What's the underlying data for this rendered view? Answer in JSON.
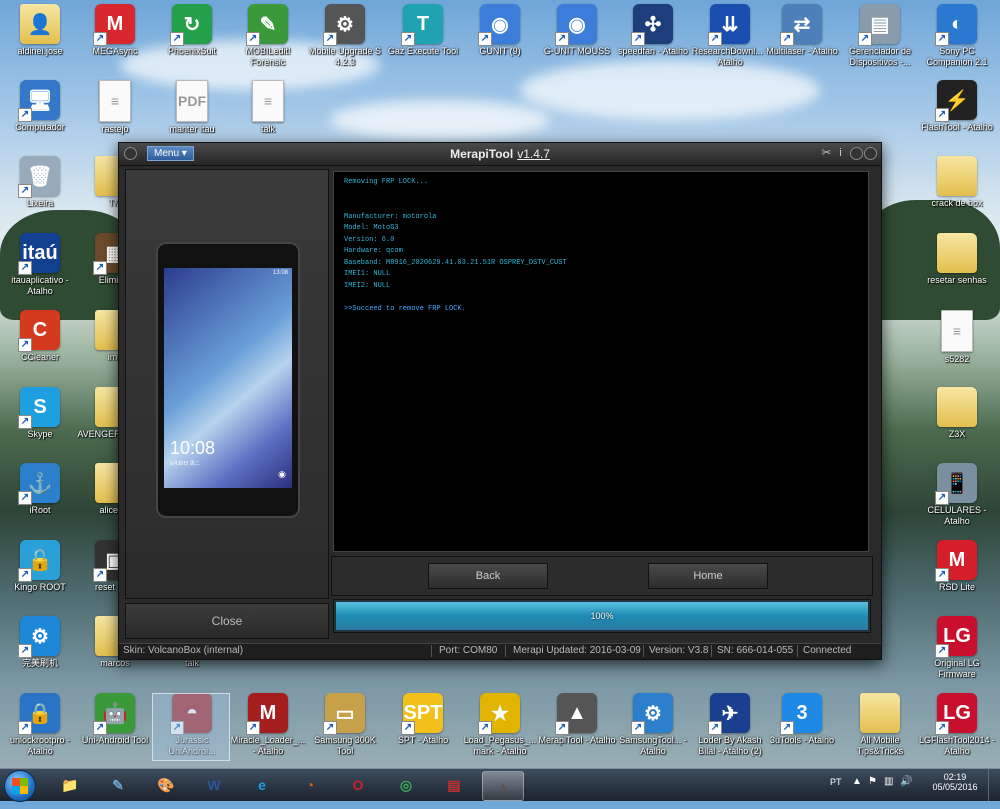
{
  "desktop": {
    "icons": [
      {
        "label": "aldinei.jose",
        "glyph": "👤",
        "kind": "folder",
        "color": "#e3bf4e"
      },
      {
        "label": "MEGAsync",
        "glyph": "M",
        "kind": "app",
        "color": "#d9272e"
      },
      {
        "label": "PhoenixSuit",
        "glyph": "↻",
        "kind": "app",
        "color": "#24a04a"
      },
      {
        "label": "MOBILedit! Forensic",
        "glyph": "✎",
        "kind": "app",
        "color": "#3a9a3a"
      },
      {
        "label": "Mobile Upgrade S 4.2.3",
        "glyph": "⚙",
        "kind": "app",
        "color": "#555"
      },
      {
        "label": "Gaz Execute Tool",
        "glyph": "T",
        "kind": "app",
        "color": "#1fa3b0"
      },
      {
        "label": "GUNIT (9)",
        "glyph": "◉",
        "kind": "app",
        "color": "#3b7dd8"
      },
      {
        "label": "G-UNIT MOUSS",
        "glyph": "◉",
        "kind": "app",
        "color": "#3b7dd8"
      },
      {
        "label": "speedfan - Atalho",
        "glyph": "✣",
        "kind": "app",
        "color": "#1d3e7a"
      },
      {
        "label": "ResearchDownl... - Atalho",
        "glyph": "⇊",
        "kind": "app",
        "color": "#1a4fb0"
      },
      {
        "label": "Multilaser - Atalho",
        "glyph": "⇄",
        "kind": "app",
        "color": "#4d7fb8"
      },
      {
        "label": "Gerenciador de Dispositivos -...",
        "glyph": "▤",
        "kind": "app",
        "color": "#8a9bab"
      },
      {
        "label": "Sony PC Companion 2.1",
        "glyph": "◐",
        "kind": "app",
        "color": "#2b78d0"
      },
      {
        "label": "Computador",
        "glyph": "🖥",
        "kind": "app",
        "color": "#3577c8"
      },
      {
        "label": "rastejo",
        "glyph": "≡",
        "kind": "doc",
        "color": "#ffffff"
      },
      {
        "label": "manter itau",
        "glyph": "PDF",
        "kind": "doc",
        "color": "#ffffff"
      },
      {
        "label": "talk",
        "glyph": "≡",
        "kind": "doc",
        "color": "#ffffff"
      },
      {
        "label": "FlashTool - Atalho",
        "glyph": "⚡",
        "kind": "app",
        "color": "#222"
      },
      {
        "label": "Lixeira",
        "glyph": "🗑",
        "kind": "app",
        "color": "#9ab"
      },
      {
        "label": "TM",
        "glyph": "",
        "kind": "folder",
        "color": "#e3bf4e"
      },
      {
        "label": "crack de box",
        "glyph": "",
        "kind": "folder",
        "color": "#e3bf4e"
      },
      {
        "label": "itauaplicativo - Atalho",
        "glyph": "itaú",
        "kind": "app",
        "color": "#123f8f"
      },
      {
        "label": "Eliminar",
        "glyph": "▦",
        "kind": "app",
        "color": "#6b4b2b"
      },
      {
        "label": "resetar senhas",
        "glyph": "",
        "kind": "folder",
        "color": "#e3bf4e"
      },
      {
        "label": "CCleaner",
        "glyph": "C",
        "kind": "app",
        "color": "#d43a1e"
      },
      {
        "label": "ime",
        "glyph": "",
        "kind": "folder",
        "color": "#e3bf4e"
      },
      {
        "label": "s5282",
        "glyph": "≡",
        "kind": "doc",
        "color": "#ffffff"
      },
      {
        "label": "Skype",
        "glyph": "S",
        "kind": "app",
        "color": "#1e9fe0"
      },
      {
        "label": "AVENGER 1.0 Cra",
        "glyph": "",
        "kind": "folder",
        "color": "#e3bf4e"
      },
      {
        "label": "Z3X",
        "glyph": "",
        "kind": "folder",
        "color": "#e3bf4e"
      },
      {
        "label": "iRoot",
        "glyph": "⚓",
        "kind": "app",
        "color": "#2b7fcb"
      },
      {
        "label": "alice na",
        "glyph": "",
        "kind": "folder",
        "color": "#e3bf4e"
      },
      {
        "label": "CELULARES - Atalho",
        "glyph": "📱",
        "kind": "app",
        "color": "#7a8fa0"
      },
      {
        "label": "Kingo ROOT",
        "glyph": "🔓",
        "kind": "app",
        "color": "#2aa0d8"
      },
      {
        "label": "reset gma",
        "glyph": "▣",
        "kind": "app",
        "color": "#333"
      },
      {
        "label": "RSD Lite",
        "glyph": "M",
        "kind": "app",
        "color": "#d41e2a"
      },
      {
        "label": "完美刷机",
        "glyph": "⚙",
        "kind": "app",
        "color": "#1e88d8"
      },
      {
        "label": "marcos",
        "glyph": "",
        "kind": "folder",
        "color": "#e3bf4e"
      },
      {
        "label": "talk",
        "glyph": "",
        "kind": "none",
        "color": "#000"
      },
      {
        "label": "Original LG Firmware",
        "glyph": "LG",
        "kind": "app",
        "color": "#c8102e"
      },
      {
        "label": "unlockrootpro - Atalho",
        "glyph": "🔒",
        "kind": "app",
        "color": "#2a74c8"
      },
      {
        "label": "Uni-Android Tool",
        "glyph": "🤖",
        "kind": "app",
        "color": "#3a9a3a"
      },
      {
        "label": "Jurassic UniAndroi...",
        "glyph": "◓",
        "kind": "app",
        "color": "#a01e1e"
      },
      {
        "label": "Miracle_Loader_... - Atalho",
        "glyph": "M",
        "kind": "app",
        "color": "#a41e1e"
      },
      {
        "label": "Samsung 300K Tool",
        "glyph": "▭",
        "kind": "app",
        "color": "#c6a14a"
      },
      {
        "label": "SPT - Atalho",
        "glyph": "SPT",
        "kind": "app",
        "color": "#f2c01b"
      },
      {
        "label": "Load_Pegasus_... mark - Atalho",
        "glyph": "★",
        "kind": "app",
        "color": "#e0b400"
      },
      {
        "label": "MerapiTool - Atalho",
        "glyph": "▲",
        "kind": "app",
        "color": "#555"
      },
      {
        "label": "SamsungTool... - Atalho",
        "glyph": "⚙",
        "kind": "app",
        "color": "#2b7fcb"
      },
      {
        "label": "Loder By Akash Bilal - Atalho (2)",
        "glyph": "✈",
        "kind": "app",
        "color": "#1a3f8f"
      },
      {
        "label": "3uTools - Atalho",
        "glyph": "3",
        "kind": "app",
        "color": "#1e88e5"
      },
      {
        "label": "All Mobile Tips&Tricks",
        "glyph": "",
        "kind": "folder",
        "color": "#e3bf4e"
      },
      {
        "label": "LGFlashTool2014 - Atalho",
        "glyph": "LG",
        "kind": "app",
        "color": "#c8102e"
      }
    ]
  },
  "window": {
    "menu_label": "Menu ▾",
    "title": "MerapiTool",
    "version": "v1.4.7",
    "close_button": "Close",
    "console_lines": [
      "Removing FRP LOCK...",
      "",
      "",
      "Manufacturer: motorola",
      "Model: MotoG3",
      "Version: 6.0",
      "Hardware: qcom",
      "Baseband: M8916_2020629.41.03.21.51R OSPREY_DSTV_CUST",
      "IMEI1: NULL",
      "IMEI2: NULL",
      "",
      ">>Succeed to remove FRP LOCK."
    ],
    "back_button": "Back",
    "home_button": "Home",
    "progress": 100,
    "progress_label": "100%",
    "phone_time": "10:08",
    "phone_date": "6月30日  周二",
    "phone_status": "13:08",
    "status": {
      "skin": "Skin: VolcanoBox (internal)",
      "port": "Port: COM80",
      "updated": "Merapi Updated: 2016-03-09",
      "version": "Version: V3.8",
      "sn": "SN: 666-014-055",
      "connection": "Connected"
    }
  },
  "taskbar": {
    "language": "PT",
    "time": "02:19",
    "date": "05/05/2016",
    "pinned": [
      {
        "name": "explorer",
        "glyph": "📁",
        "color": "#e3bf4e"
      },
      {
        "name": "notepad",
        "glyph": "✎",
        "color": "#6aa0c8"
      },
      {
        "name": "paint",
        "glyph": "🎨",
        "color": "#c8a060"
      },
      {
        "name": "word",
        "glyph": "W",
        "color": "#2b579a"
      },
      {
        "name": "ie",
        "glyph": "e",
        "color": "#1ea0e0"
      },
      {
        "name": "firefox",
        "glyph": "◔",
        "color": "#e66000"
      },
      {
        "name": "opera",
        "glyph": "O",
        "color": "#d01e2e"
      },
      {
        "name": "chrome",
        "glyph": "◎",
        "color": "#3aa757"
      },
      {
        "name": "toolbox",
        "glyph": "▤",
        "color": "#c03030"
      },
      {
        "name": "merapitool",
        "glyph": "▲",
        "color": "#555"
      }
    ]
  }
}
